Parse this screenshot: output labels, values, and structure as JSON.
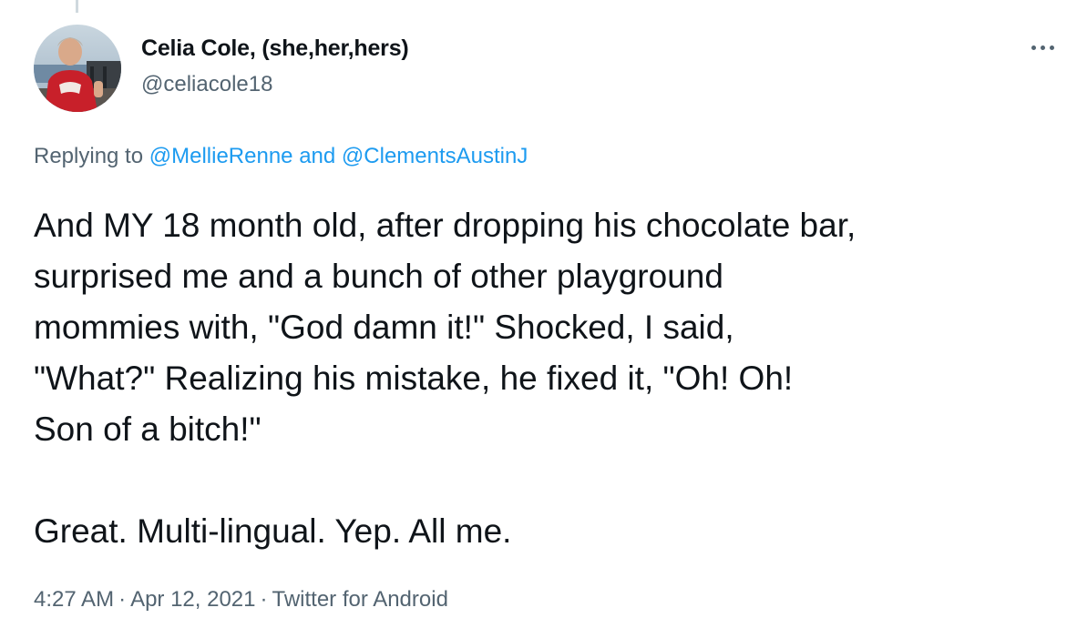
{
  "author": {
    "display_name": "Celia Cole, (she,her,hers)",
    "handle": "@celiacole18",
    "avatar_icon": "profile-photo"
  },
  "more_icon": "more-horizontal-icon",
  "reply": {
    "prefix": "Replying to ",
    "mentions": [
      "@MellieRenne",
      "@ClementsAustinJ"
    ],
    "joiner": " and "
  },
  "tweet": {
    "paragraph_1": "And MY 18 month old, after dropping his chocolate bar,\nsurprised me and a bunch of other playground\nmommies with, \"God damn it!\" Shocked, I said,\n\"What?\" Realizing his mistake, he fixed it, \"Oh! Oh!\nSon of a bitch!\"",
    "paragraph_2": "Great. Multi-lingual. Yep. All me."
  },
  "meta": {
    "time": "4:27 AM",
    "date": "Apr 12, 2021",
    "source": "Twitter for Android",
    "separator": "·"
  },
  "colors": {
    "text": "#0f1419",
    "secondary": "#536471",
    "link": "#1d9bf0"
  }
}
